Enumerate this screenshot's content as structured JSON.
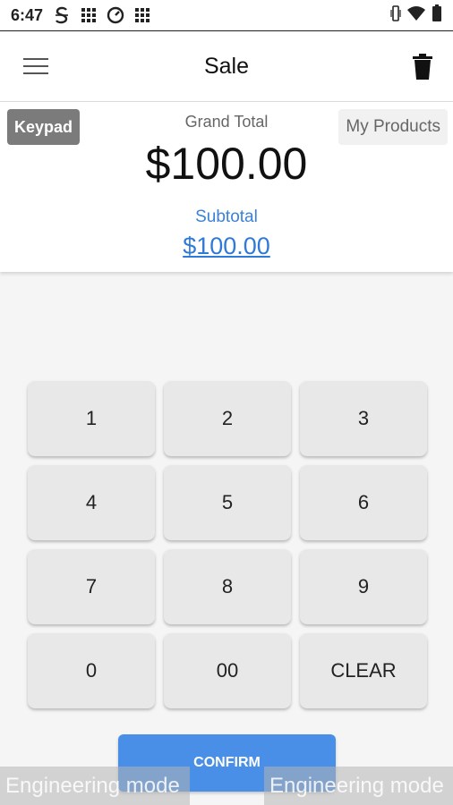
{
  "status": {
    "time": "6:47",
    "icons": [
      "s-icon",
      "grid-icon",
      "gauge-icon",
      "grid-icon"
    ],
    "right_icons": [
      "vibrate-icon",
      "wifi-icon",
      "battery-icon"
    ]
  },
  "app_bar": {
    "title": "Sale"
  },
  "totals": {
    "keypad_label": "Keypad",
    "products_label": "My Products",
    "grand_total_label": "Grand Total",
    "grand_total_value": "$100.00",
    "subtotal_label": "Subtotal",
    "subtotal_value": "$100.00"
  },
  "keypad": {
    "keys": [
      "1",
      "2",
      "3",
      "4",
      "5",
      "6",
      "7",
      "8",
      "9",
      "0",
      "00",
      "CLEAR"
    ]
  },
  "actions": {
    "confirm_label": "CONFIRM"
  },
  "overlay": {
    "engineering_left": "Engineering mode",
    "engineering_right": "Engineering mode"
  },
  "colors": {
    "accent": "#4a8fe7",
    "link": "#2f7ad8",
    "keypad_tab_bg": "#7b7b7b"
  }
}
